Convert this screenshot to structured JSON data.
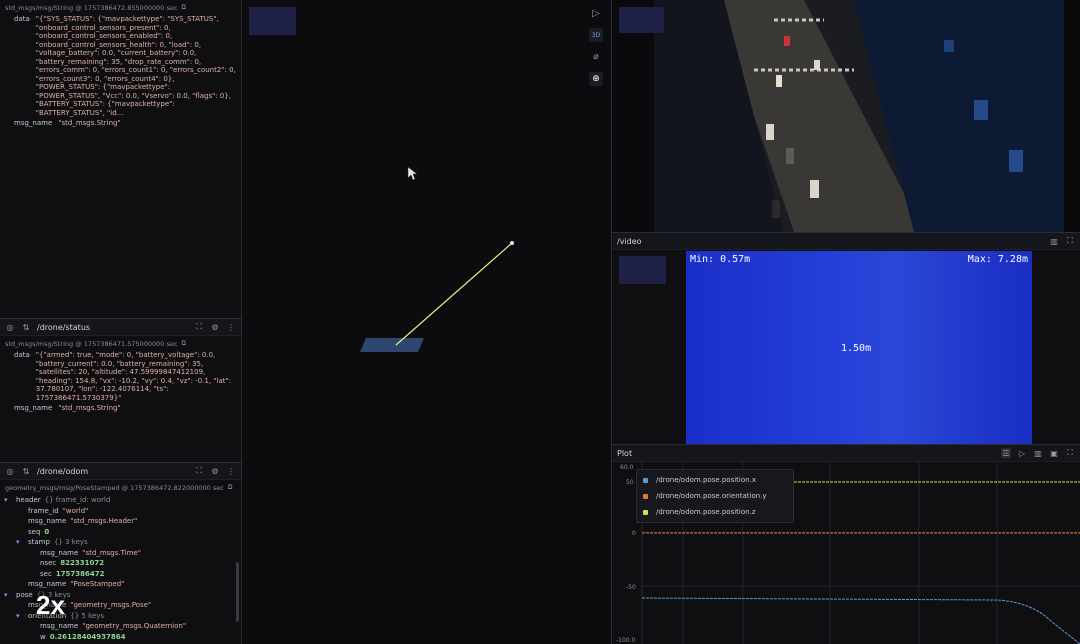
{
  "left": {
    "panel1": {
      "meta": "std_msgs/msg/String @ 1757386472.855000000 sec",
      "data_key": "data",
      "data_value": "\"{\"SYS_STATUS\": {\"mavpackettype\": \"SYS_STATUS\", \"onboard_control_sensors_present\": 0, \"onboard_control_sensors_enabled\": 0, \"onboard_control_sensors_health\": 0, \"load\": 0, \"voltage_battery\": 0.0, \"current_battery\": 0.0, \"battery_remaining\": 35, \"drop_rate_comm\": 0, \"errors_comm\": 0, \"errors_count1\": 0, \"errors_count2\": 0, \"errors_count3\": 0, \"errors_count4\": 0}, \"POWER_STATUS\": {\"mavpackettype\": \"POWER_STATUS\", \"Vcc\": 0.0, \"Vservo\": 0.0, \"flags\": 0}, \"BATTERY_STATUS\": {\"mavpackettype\": \"BATTERY_STATUS\", \"id...",
      "msgname_key": "msg_name",
      "msgname_value": "\"std_msgs.String\""
    },
    "panel2": {
      "topic": "/drone/status",
      "meta": "std_msgs/msg/String @ 1757386471.575000000 sec",
      "data_key": "data",
      "data_value": "\"{\"armed\": true, \"mode\": 0, \"battery_voltage\": 0.0, \"battery_current\": 0.0, \"battery_remaining\": 35, \"satellites\": 20, \"altitude\": 47.59999847412109, \"heading\": 154.8, \"vx\": -10.2, \"vy\": 0.4, \"vz\": -0.1, \"lat\": 37.780107, \"lon\": -122.4076114, \"ts\": 1757386471.5730379}\"",
      "msgname_key": "msg_name",
      "msgname_value": "\"std_msgs.String\""
    },
    "panel3": {
      "topic": "/drone/odom",
      "meta": "geometry_msgs/msg/PoseStamped @ 1757386472.822000000 sec",
      "rows": [
        {
          "indent": 0,
          "tri": "▾",
          "key": "header",
          "val": "{} frame_id: world",
          "cls": "sub"
        },
        {
          "indent": 1,
          "tri": "",
          "key": "frame_id",
          "val": "\"world\"",
          "cls": "str"
        },
        {
          "indent": 1,
          "tri": "",
          "key": "msg_name",
          "val": "\"std_msgs.Header\"",
          "cls": "str"
        },
        {
          "indent": 1,
          "tri": "",
          "key": "seq",
          "val": "0",
          "cls": "num"
        },
        {
          "indent": 1,
          "tri": "▾",
          "key": "stamp",
          "val": "{} 3 keys",
          "cls": "sub"
        },
        {
          "indent": 2,
          "tri": "",
          "key": "msg_name",
          "val": "\"std_msgs.Time\"",
          "cls": "str"
        },
        {
          "indent": 2,
          "tri": "",
          "key": "nsec",
          "val": "822331072",
          "cls": "num"
        },
        {
          "indent": 2,
          "tri": "",
          "key": "sec",
          "val": "1757386472",
          "cls": "num"
        },
        {
          "indent": 1,
          "tri": "",
          "key": "msg_name",
          "val": "\"PoseStamped\"",
          "cls": "str"
        },
        {
          "indent": 0,
          "tri": "▾",
          "key": "pose",
          "val": "{} 3 keys",
          "cls": "sub"
        },
        {
          "indent": 1,
          "tri": "",
          "key": "msg_name",
          "val": "\"geometry_msgs.Pose\"",
          "cls": "str"
        },
        {
          "indent": 1,
          "tri": "▾",
          "key": "orientation",
          "val": "{} 5 keys",
          "cls": "sub"
        },
        {
          "indent": 2,
          "tri": "",
          "key": "msg_name",
          "val": "\"geometry_msgs.Quaternion\"",
          "cls": "str"
        },
        {
          "indent": 2,
          "tri": "",
          "key": "w",
          "val": "0.26128404937864",
          "cls": "num"
        }
      ]
    }
  },
  "center": {
    "badge": "3D"
  },
  "video": {
    "topic": "/video"
  },
  "depth": {
    "min_label": "Min: 0.57m",
    "max_label": "Max: 7.28m",
    "center_label": "1.50m"
  },
  "plot": {
    "title": "Plot",
    "legend": [
      {
        "name": "/drone/odom.pose.position.x",
        "color": "#5b9bd5"
      },
      {
        "name": "/drone/odom.pose.orientation.y",
        "color": "#e07b39"
      },
      {
        "name": "/drone/odom.pose.position.z",
        "color": "#d4e157"
      }
    ],
    "yticks": [
      "60.0",
      "50",
      "0",
      "-50",
      "-100.0"
    ]
  },
  "overlay": "2x",
  "colors": {
    "accent": "#7c9bf0",
    "depth": "#1b2fd0"
  }
}
